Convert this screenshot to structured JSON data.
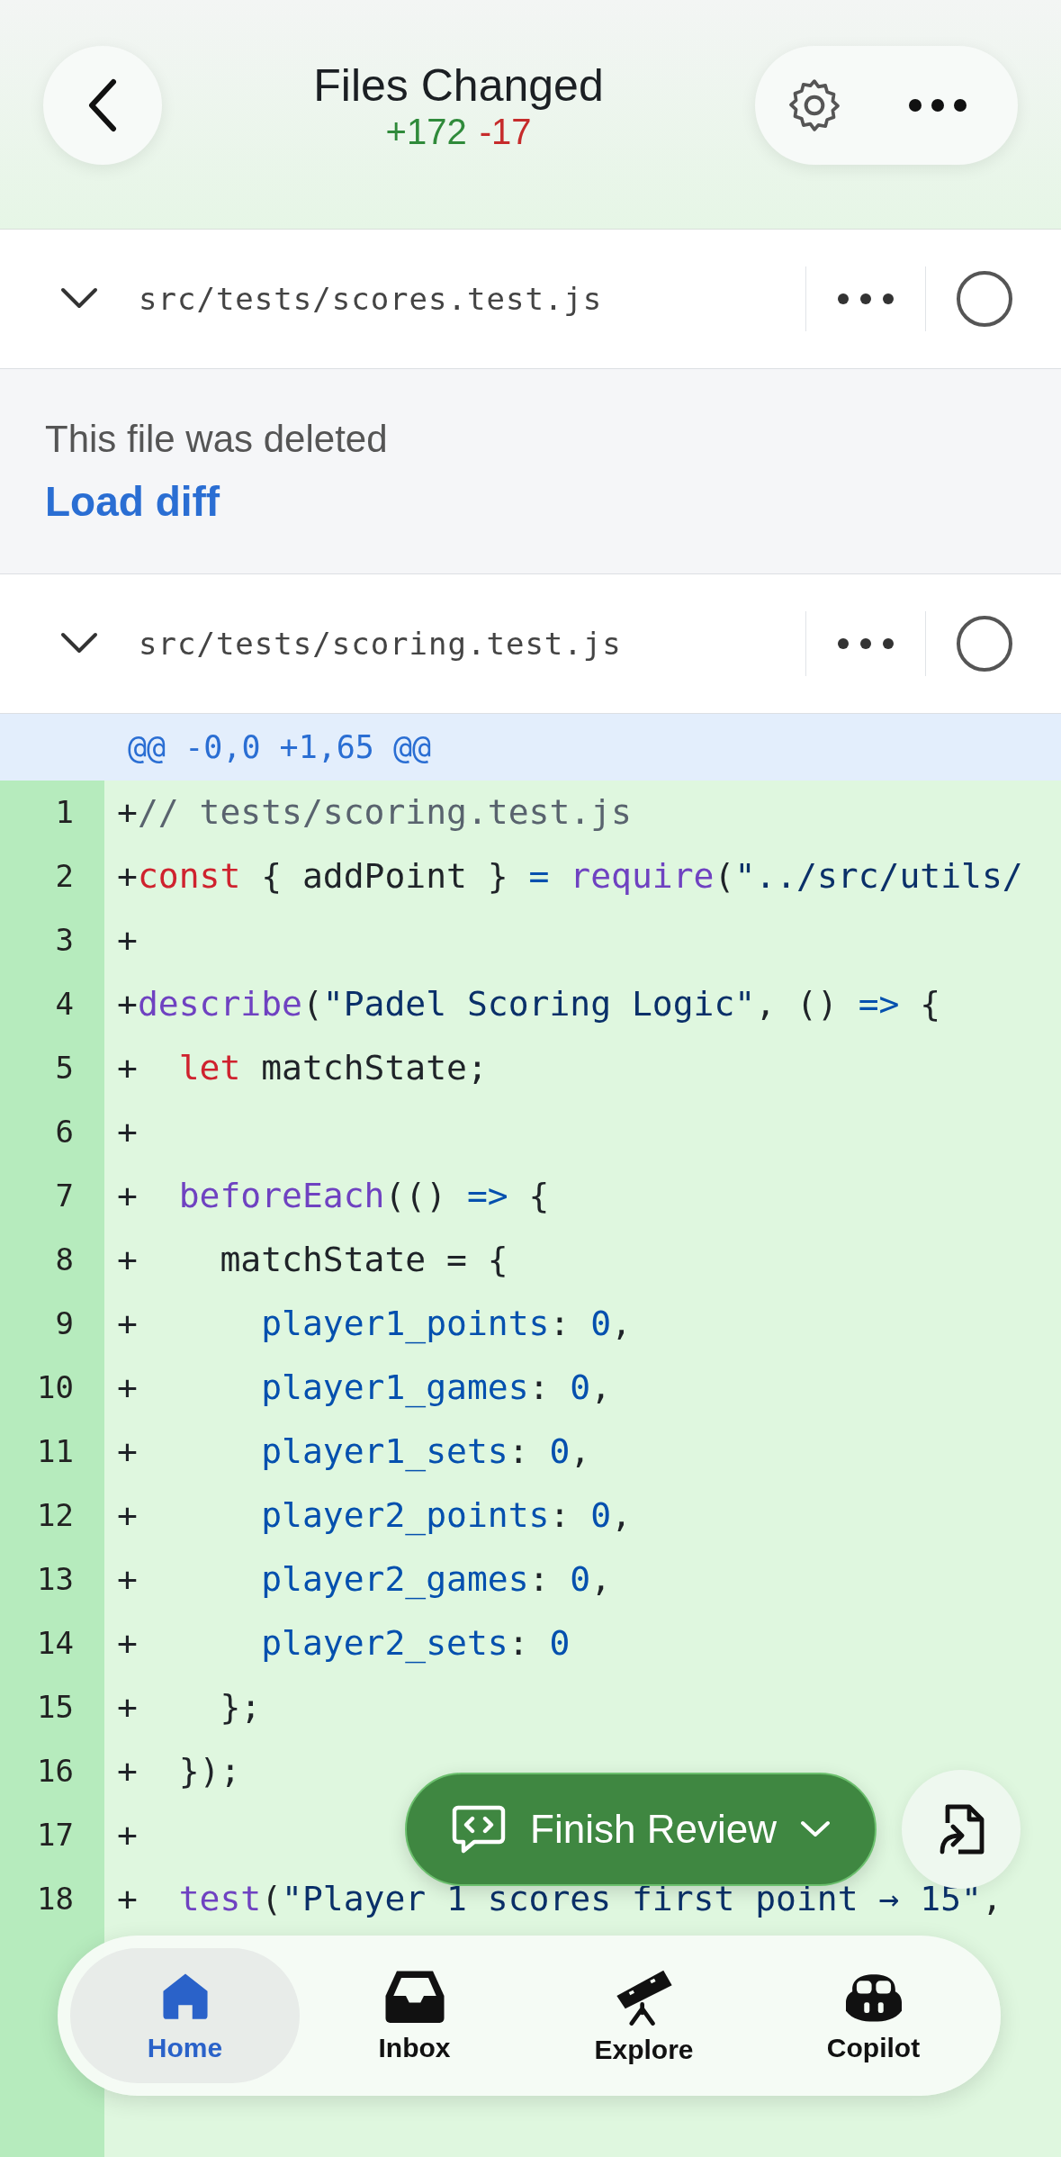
{
  "header": {
    "title": "Files Changed",
    "additions": "+172",
    "deletions": "-17"
  },
  "files": [
    {
      "kind": "deleted",
      "path": "src/tests/scores.test.js",
      "viewed": false,
      "notice": "This file was deleted",
      "action": "Load diff"
    },
    {
      "kind": "diff",
      "path": "src/tests/scoring.test.js",
      "viewed": false,
      "hunk": "@@ -0,0 +1,65 @@",
      "lines": [
        {
          "n": "1",
          "tokens": [
            {
              "t": "+",
              "kind": "plain"
            },
            {
              "t": "// tests/scoring.test.js",
              "kind": "comment"
            }
          ]
        },
        {
          "n": "2",
          "tokens": [
            {
              "t": "+",
              "kind": "plain"
            },
            {
              "t": "const",
              "kind": "keyword"
            },
            {
              "t": " { addPoint } ",
              "kind": "plain"
            },
            {
              "t": "= ",
              "kind": "operator"
            },
            {
              "t": "require",
              "kind": "function"
            },
            {
              "t": "(",
              "kind": "plain"
            },
            {
              "t": "\"../src/utils/",
              "kind": "string"
            }
          ]
        },
        {
          "n": "3",
          "tokens": [
            {
              "t": "+",
              "kind": "plain"
            }
          ]
        },
        {
          "n": "4",
          "tokens": [
            {
              "t": "+",
              "kind": "plain"
            },
            {
              "t": "describe",
              "kind": "function"
            },
            {
              "t": "(",
              "kind": "plain"
            },
            {
              "t": "\"Padel Scoring Logic\"",
              "kind": "string"
            },
            {
              "t": ", () ",
              "kind": "plain"
            },
            {
              "t": "=>",
              "kind": "operator"
            },
            {
              "t": " {",
              "kind": "plain"
            }
          ]
        },
        {
          "n": "5",
          "tokens": [
            {
              "t": "+  ",
              "kind": "plain"
            },
            {
              "t": "let",
              "kind": "keyword"
            },
            {
              "t": " matchState;",
              "kind": "plain"
            }
          ]
        },
        {
          "n": "6",
          "tokens": [
            {
              "t": "+",
              "kind": "plain"
            }
          ]
        },
        {
          "n": "7",
          "tokens": [
            {
              "t": "+  ",
              "kind": "plain"
            },
            {
              "t": "beforeEach",
              "kind": "function"
            },
            {
              "t": "(() ",
              "kind": "plain"
            },
            {
              "t": "=>",
              "kind": "operator"
            },
            {
              "t": " {",
              "kind": "plain"
            }
          ]
        },
        {
          "n": "8",
          "tokens": [
            {
              "t": "+    matchState = {",
              "kind": "plain"
            }
          ]
        },
        {
          "n": "9",
          "tokens": [
            {
              "t": "+      ",
              "kind": "plain"
            },
            {
              "t": "player1_points",
              "kind": "property"
            },
            {
              "t": ": ",
              "kind": "plain"
            },
            {
              "t": "0",
              "kind": "property"
            },
            {
              "t": ",",
              "kind": "plain"
            }
          ]
        },
        {
          "n": "10",
          "tokens": [
            {
              "t": "+      ",
              "kind": "plain"
            },
            {
              "t": "player1_games",
              "kind": "property"
            },
            {
              "t": ": ",
              "kind": "plain"
            },
            {
              "t": "0",
              "kind": "property"
            },
            {
              "t": ",",
              "kind": "plain"
            }
          ]
        },
        {
          "n": "11",
          "tokens": [
            {
              "t": "+      ",
              "kind": "plain"
            },
            {
              "t": "player1_sets",
              "kind": "property"
            },
            {
              "t": ": ",
              "kind": "plain"
            },
            {
              "t": "0",
              "kind": "property"
            },
            {
              "t": ",",
              "kind": "plain"
            }
          ]
        },
        {
          "n": "12",
          "tokens": [
            {
              "t": "+      ",
              "kind": "plain"
            },
            {
              "t": "player2_points",
              "kind": "property"
            },
            {
              "t": ": ",
              "kind": "plain"
            },
            {
              "t": "0",
              "kind": "property"
            },
            {
              "t": ",",
              "kind": "plain"
            }
          ]
        },
        {
          "n": "13",
          "tokens": [
            {
              "t": "+      ",
              "kind": "plain"
            },
            {
              "t": "player2_games",
              "kind": "property"
            },
            {
              "t": ": ",
              "kind": "plain"
            },
            {
              "t": "0",
              "kind": "property"
            },
            {
              "t": ",",
              "kind": "plain"
            }
          ]
        },
        {
          "n": "14",
          "tokens": [
            {
              "t": "+      ",
              "kind": "plain"
            },
            {
              "t": "player2_sets",
              "kind": "property"
            },
            {
              "t": ": ",
              "kind": "plain"
            },
            {
              "t": "0",
              "kind": "property"
            }
          ]
        },
        {
          "n": "15",
          "tokens": [
            {
              "t": "+    };",
              "kind": "plain"
            }
          ]
        },
        {
          "n": "16",
          "tokens": [
            {
              "t": "+  });",
              "kind": "plain"
            }
          ]
        },
        {
          "n": "17",
          "tokens": [
            {
              "t": "+",
              "kind": "plain"
            }
          ]
        },
        {
          "n": "18",
          "tokens": [
            {
              "t": "+  ",
              "kind": "plain"
            },
            {
              "t": "test",
              "kind": "function"
            },
            {
              "t": "(",
              "kind": "plain"
            },
            {
              "t": "\"Player 1 scores first point → 15\"",
              "kind": "string"
            },
            {
              "t": ",",
              "kind": "plain"
            }
          ]
        }
      ]
    }
  ],
  "finish_review": {
    "label": "Finish Review"
  },
  "nav": [
    {
      "kind": "home",
      "label": "Home",
      "selected": true
    },
    {
      "kind": "inbox",
      "label": "Inbox",
      "selected": false
    },
    {
      "kind": "explore",
      "label": "Explore",
      "selected": false
    },
    {
      "kind": "copilot",
      "label": "Copilot",
      "selected": false
    }
  ]
}
